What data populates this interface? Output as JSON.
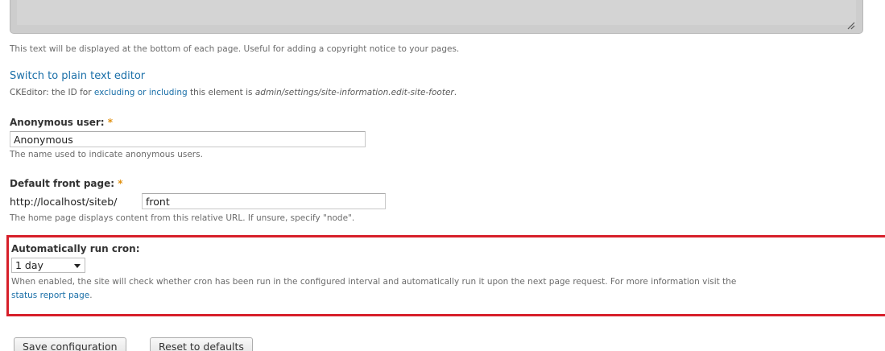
{
  "footer": {
    "description": "This text will be displayed at the bottom of each page. Useful for adding a copyright notice to your pages.",
    "switch_editor_link": "Switch to plain text editor",
    "ck_prefix": "CKEditor: the ID for ",
    "ck_link": "excluding or including",
    "ck_middle": " this element is ",
    "ck_id": "admin/settings/site-information.edit-site-footer",
    "ck_suffix": "."
  },
  "anonymous": {
    "label": "Anonymous user:",
    "required_mark": "*",
    "value": "Anonymous",
    "description": "The name used to indicate anonymous users."
  },
  "front_page": {
    "label": "Default front page:",
    "required_mark": "*",
    "prefix": "http://localhost/siteb/",
    "value": "front",
    "description": "The home page displays content from this relative URL. If unsure, specify \"node\"."
  },
  "cron": {
    "label": "Automatically run cron:",
    "selected": "1 day",
    "description": "When enabled, the site will check whether cron has been run in the configured interval and automatically run it upon the next page request. For more information visit the",
    "link": "status report page",
    "link_suffix": "."
  },
  "actions": {
    "save_label": "Save configuration",
    "reset_label": "Reset to defaults"
  },
  "colors": {
    "highlight": "#d71f2a",
    "link": "#1a6fa8",
    "required": "#e09010"
  }
}
